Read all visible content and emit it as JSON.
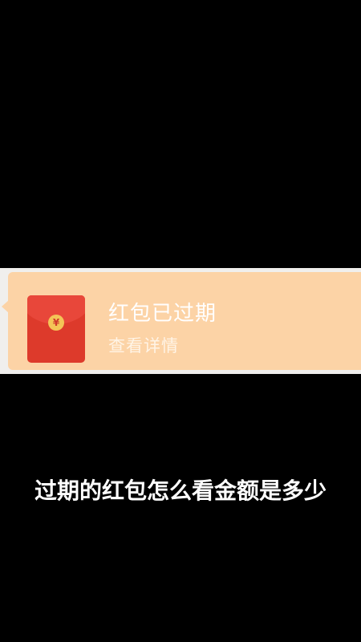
{
  "red_packet": {
    "status_title": "红包已过期",
    "details_link": "查看详情",
    "currency_symbol": "¥"
  },
  "caption": {
    "text": "过期的红包怎么看金额是多少"
  },
  "colors": {
    "background": "#000000",
    "chat_background": "#f0efed",
    "bubble": "#fcd3a6",
    "envelope": "#dd3a2b",
    "coin": "#f4c457"
  }
}
